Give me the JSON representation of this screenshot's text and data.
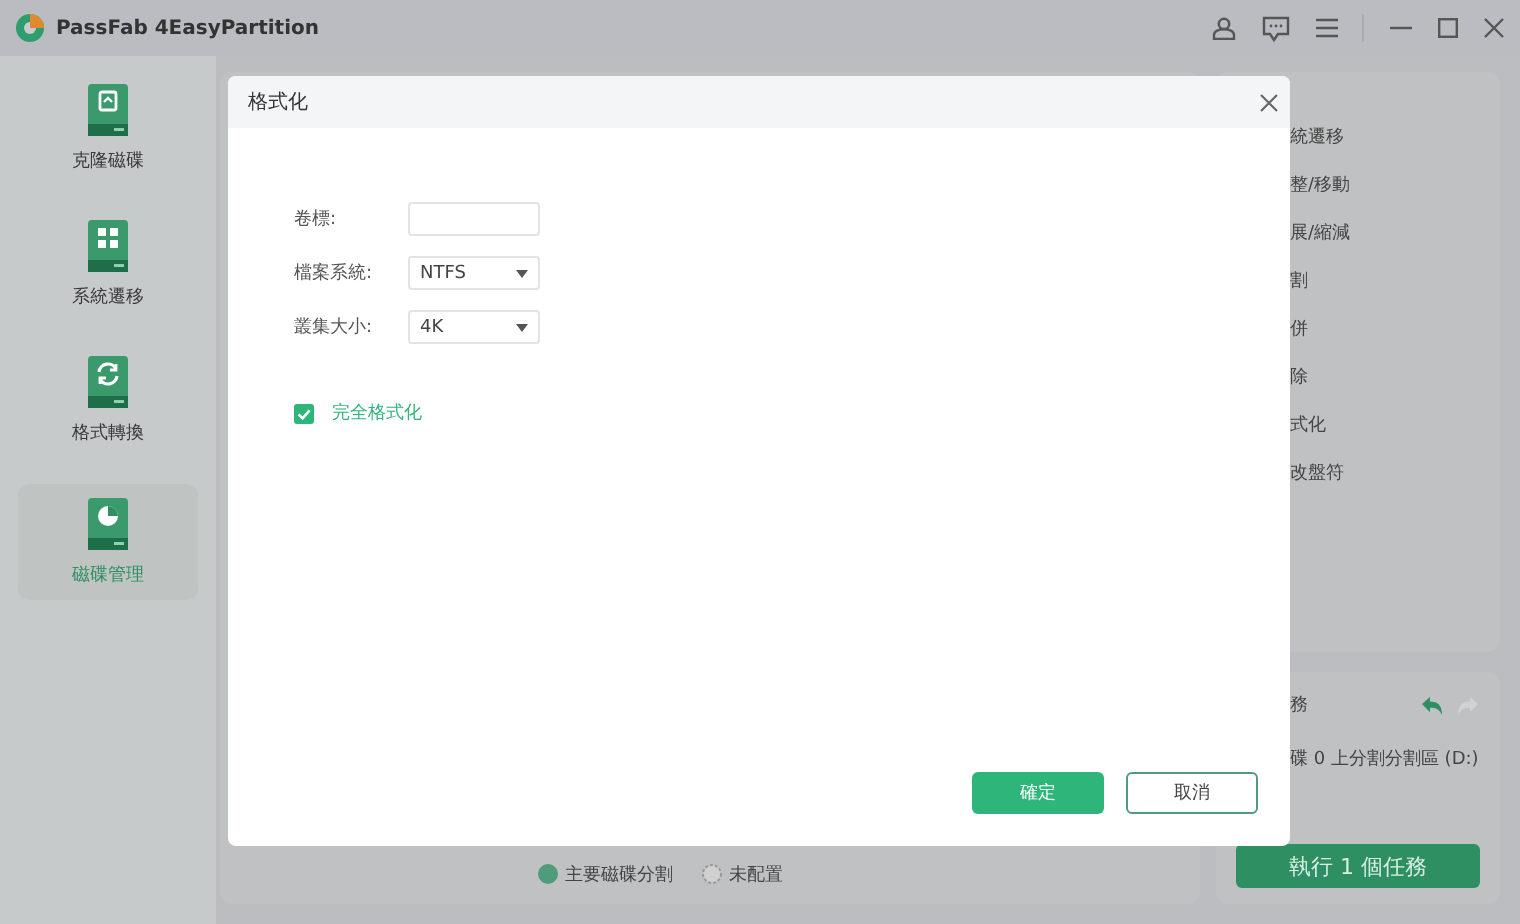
{
  "window": {
    "title": "PassFab 4EasyPartition"
  },
  "sidebar": {
    "items": [
      {
        "label": "克隆磁碟",
        "selected": false
      },
      {
        "label": "系統遷移",
        "selected": false
      },
      {
        "label": "格式轉換",
        "selected": false
      },
      {
        "label": "磁碟管理",
        "selected": true
      }
    ]
  },
  "legend": [
    {
      "label": "主要磁碟分割",
      "kind": "primary"
    },
    {
      "label": "未配置",
      "kind": "unallocated"
    }
  ],
  "operations": {
    "items": [
      "統遷移",
      "整/移動",
      "展/縮減",
      "割",
      "併",
      "除",
      "式化",
      "改盤符"
    ]
  },
  "pending": {
    "title": "務",
    "tasks": [
      "碟 0 上分割分割區 (D:)"
    ],
    "execute_button": "執行 1 個任務"
  },
  "dialog": {
    "title": "格式化",
    "fields": [
      {
        "label": "卷標:",
        "kind": "text"
      },
      {
        "label": "檔案系統:",
        "kind": "select",
        "value": "NTFS"
      },
      {
        "label": "叢集大小:",
        "kind": "select",
        "value": "4K"
      }
    ],
    "full_format": {
      "label": "完全格式化",
      "checked": true
    },
    "buttons": [
      {
        "label": "確定",
        "kind": "primary"
      },
      {
        "label": "取消",
        "kind": "secondary"
      }
    ]
  }
}
